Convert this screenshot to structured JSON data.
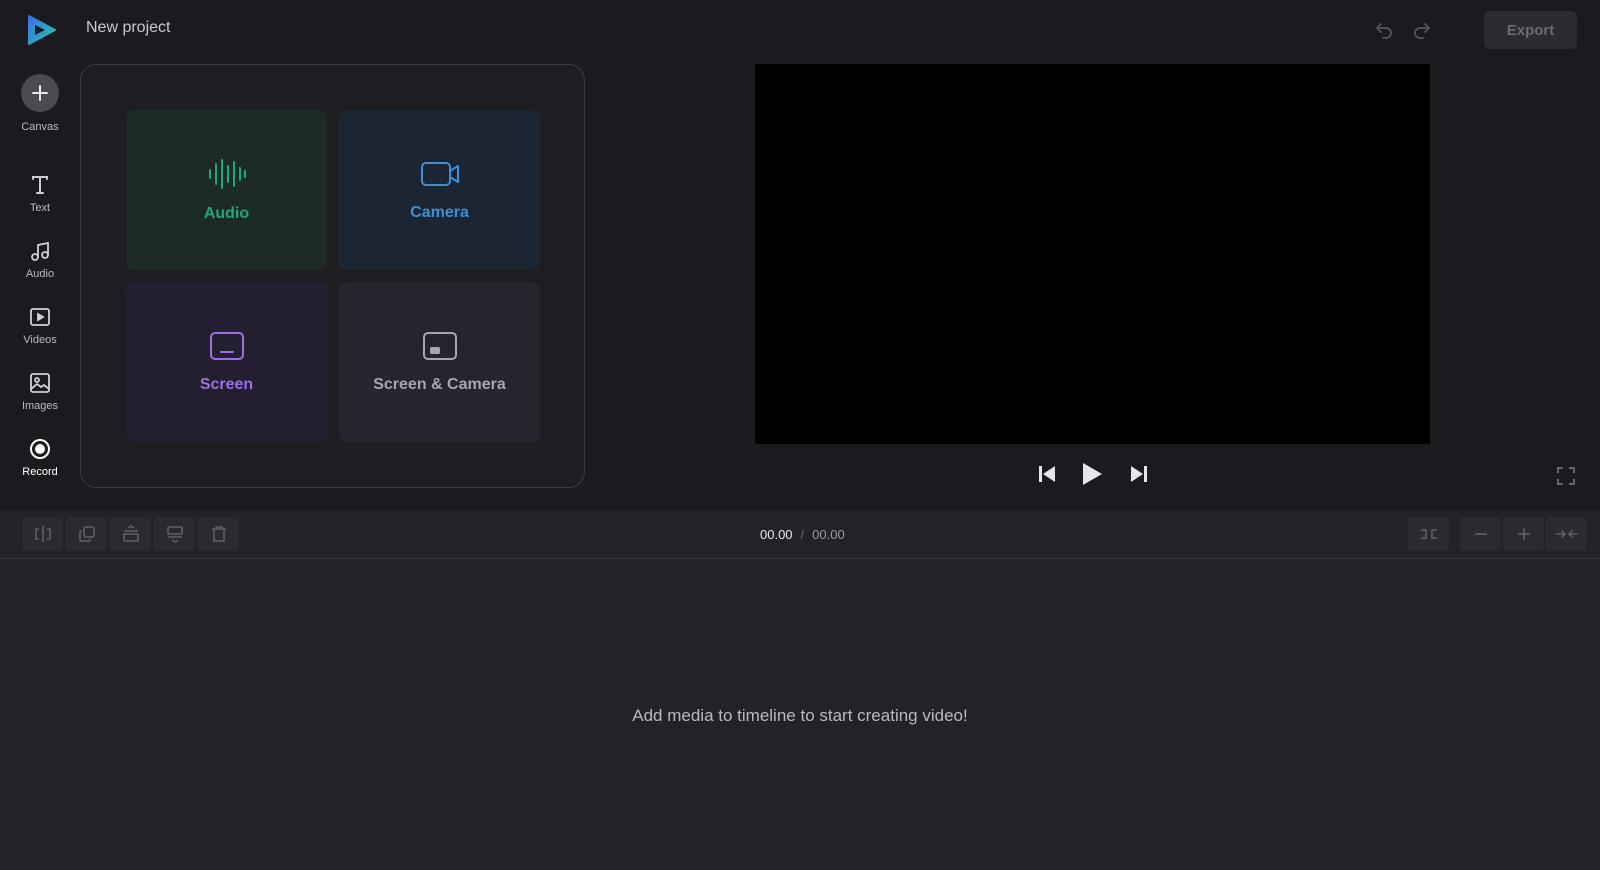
{
  "header": {
    "project_title": "New project",
    "export_label": "Export"
  },
  "sidebar": {
    "items": [
      {
        "label": "Canvas",
        "icon": "plus-icon"
      },
      {
        "label": "Text",
        "icon": "text-icon"
      },
      {
        "label": "Audio",
        "icon": "music-note-icon"
      },
      {
        "label": "Videos",
        "icon": "video-play-icon"
      },
      {
        "label": "Images",
        "icon": "image-icon"
      },
      {
        "label": "Record",
        "icon": "record-icon"
      }
    ]
  },
  "record_panel": {
    "tiles": [
      {
        "label": "Audio",
        "icon": "audio-waveform-icon",
        "color": "#22a77a"
      },
      {
        "label": "Camera",
        "icon": "camera-icon",
        "color": "#3d8fd6"
      },
      {
        "label": "Screen",
        "icon": "screen-icon",
        "color": "#9b6fe0"
      },
      {
        "label": "Screen & Camera",
        "icon": "screen-camera-icon",
        "color": "#a6a6ae"
      }
    ]
  },
  "toolbar": {
    "tools": [
      "split-icon",
      "duplicate-icon",
      "layer-up-icon",
      "layer-down-icon",
      "delete-icon"
    ],
    "time_current": "00.00",
    "time_separator": "/",
    "time_total": "00.00",
    "right_tools": [
      "fit-icon",
      "zoom-out-icon",
      "zoom-in-icon",
      "collapse-icon"
    ]
  },
  "timeline": {
    "empty_message": "Add media to timeline to start creating video!"
  }
}
